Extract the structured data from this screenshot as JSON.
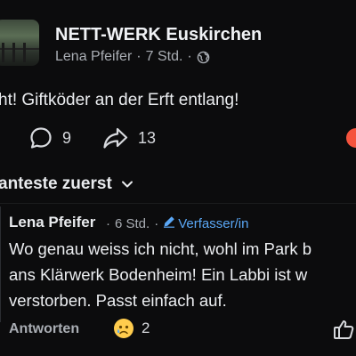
{
  "post": {
    "group_name": "NETT-WERK Euskirchen",
    "author": "Lena Pfeifer",
    "meta_sep": "·",
    "time": "7 Std.",
    "meta_sep2": "·",
    "text": "ht! Giftköder an der Erft  entlang!",
    "comments_count": "9",
    "shares_count": "13"
  },
  "sort_label": "anteste zuerst",
  "comment": {
    "author": "Lena Pfeifer",
    "sep": "·",
    "time": "6 Std.",
    "sep2": "·",
    "badge": "Verfasser/in",
    "text": "Wo genau weiss ich nicht, wohl im Park b\nans Klärwerk Bodenheim!  Ein Labbi ist w\nverstorben.  Passt einfach auf.",
    "reply_label": "Antworten",
    "reaction_count": "2"
  },
  "colors": {
    "background": "#0c0c0d",
    "link_blue": "#5aa7f5",
    "muted": "#a9adb3"
  },
  "icons": [
    "globe-icon",
    "comment-icon",
    "share-icon",
    "chevron-down-icon",
    "pencil-icon",
    "sad-emoji-icon",
    "like-icon"
  ]
}
